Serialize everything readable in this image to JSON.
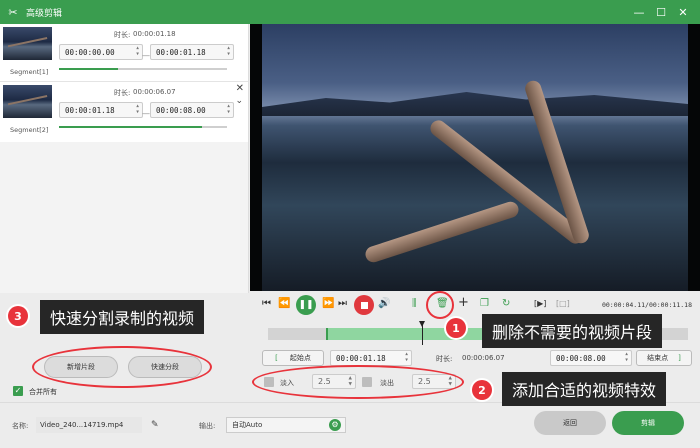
{
  "window": {
    "title": "高级剪辑",
    "logo_glyph": "✂",
    "minimize_glyph": "—",
    "maximize_glyph": "☐",
    "close_glyph": "✕"
  },
  "segments": [
    {
      "name": "Segment[1]",
      "duration_label": "时长:",
      "duration": "00:00:01.18",
      "start": "00:00:00.00",
      "end": "00:00:01.18",
      "progress": 0.35
    },
    {
      "name": "Segment[2]",
      "duration_label": "时长:",
      "duration": "00:00:06.07",
      "start": "00:00:01.18",
      "end": "00:00:08.00",
      "progress": 0.85
    }
  ],
  "segment_close_glyph": "✕",
  "segment_expand_glyph": "⌄",
  "time_range_separator": "—",
  "spin_glyph": "▲\n▼",
  "player": {
    "time_display": "00:00:04.11/00:00:11.18",
    "icons": {
      "skip_start": "⏮",
      "step_back": "⏪",
      "play": "❚❚",
      "step_forward": "⏩",
      "skip_end": "⏭",
      "volume": "🔊",
      "split": "⫼",
      "delete": "🗑",
      "add": "+",
      "copy": "❐",
      "rotate": "↻",
      "frame_left": "[▶]",
      "frame_right": "[□]"
    }
  },
  "trim": {
    "start_button": "起始点",
    "start_bracket": "[",
    "start_time": "00:00:01.18",
    "duration_label": "时长:",
    "duration": "00:00:06.07",
    "end_time": "00:00:08.00",
    "end_button": "结束点",
    "end_bracket": "]"
  },
  "effects": {
    "fade_in_label": "淡入",
    "fade_in_value": "2.5",
    "fade_out_label": "淡出",
    "fade_out_value": "2.5"
  },
  "left_actions": {
    "new_segment": "新增片段",
    "quick_split": "快速分段",
    "merge_label": "合并所有",
    "merge_checked": true,
    "check_glyph": "✓"
  },
  "footer": {
    "name_label": "名称:",
    "file_name": "Video_240...14719.mp4",
    "edit_glyph": "✎",
    "output_label": "输出:",
    "output_value": "自动Auto",
    "gear_glyph": "⚙",
    "back_button": "返回",
    "edit_button": "剪辑"
  },
  "annotations": [
    {
      "num": "1",
      "text": "删除不需要的视频片段"
    },
    {
      "num": "2",
      "text": "添加合适的视频特效"
    },
    {
      "num": "3",
      "text": "快速分割录制的视频"
    }
  ],
  "colors": {
    "brand_green": "#3a9d4f",
    "annotation_red": "#e8333b",
    "callout_bg": "#262626"
  }
}
